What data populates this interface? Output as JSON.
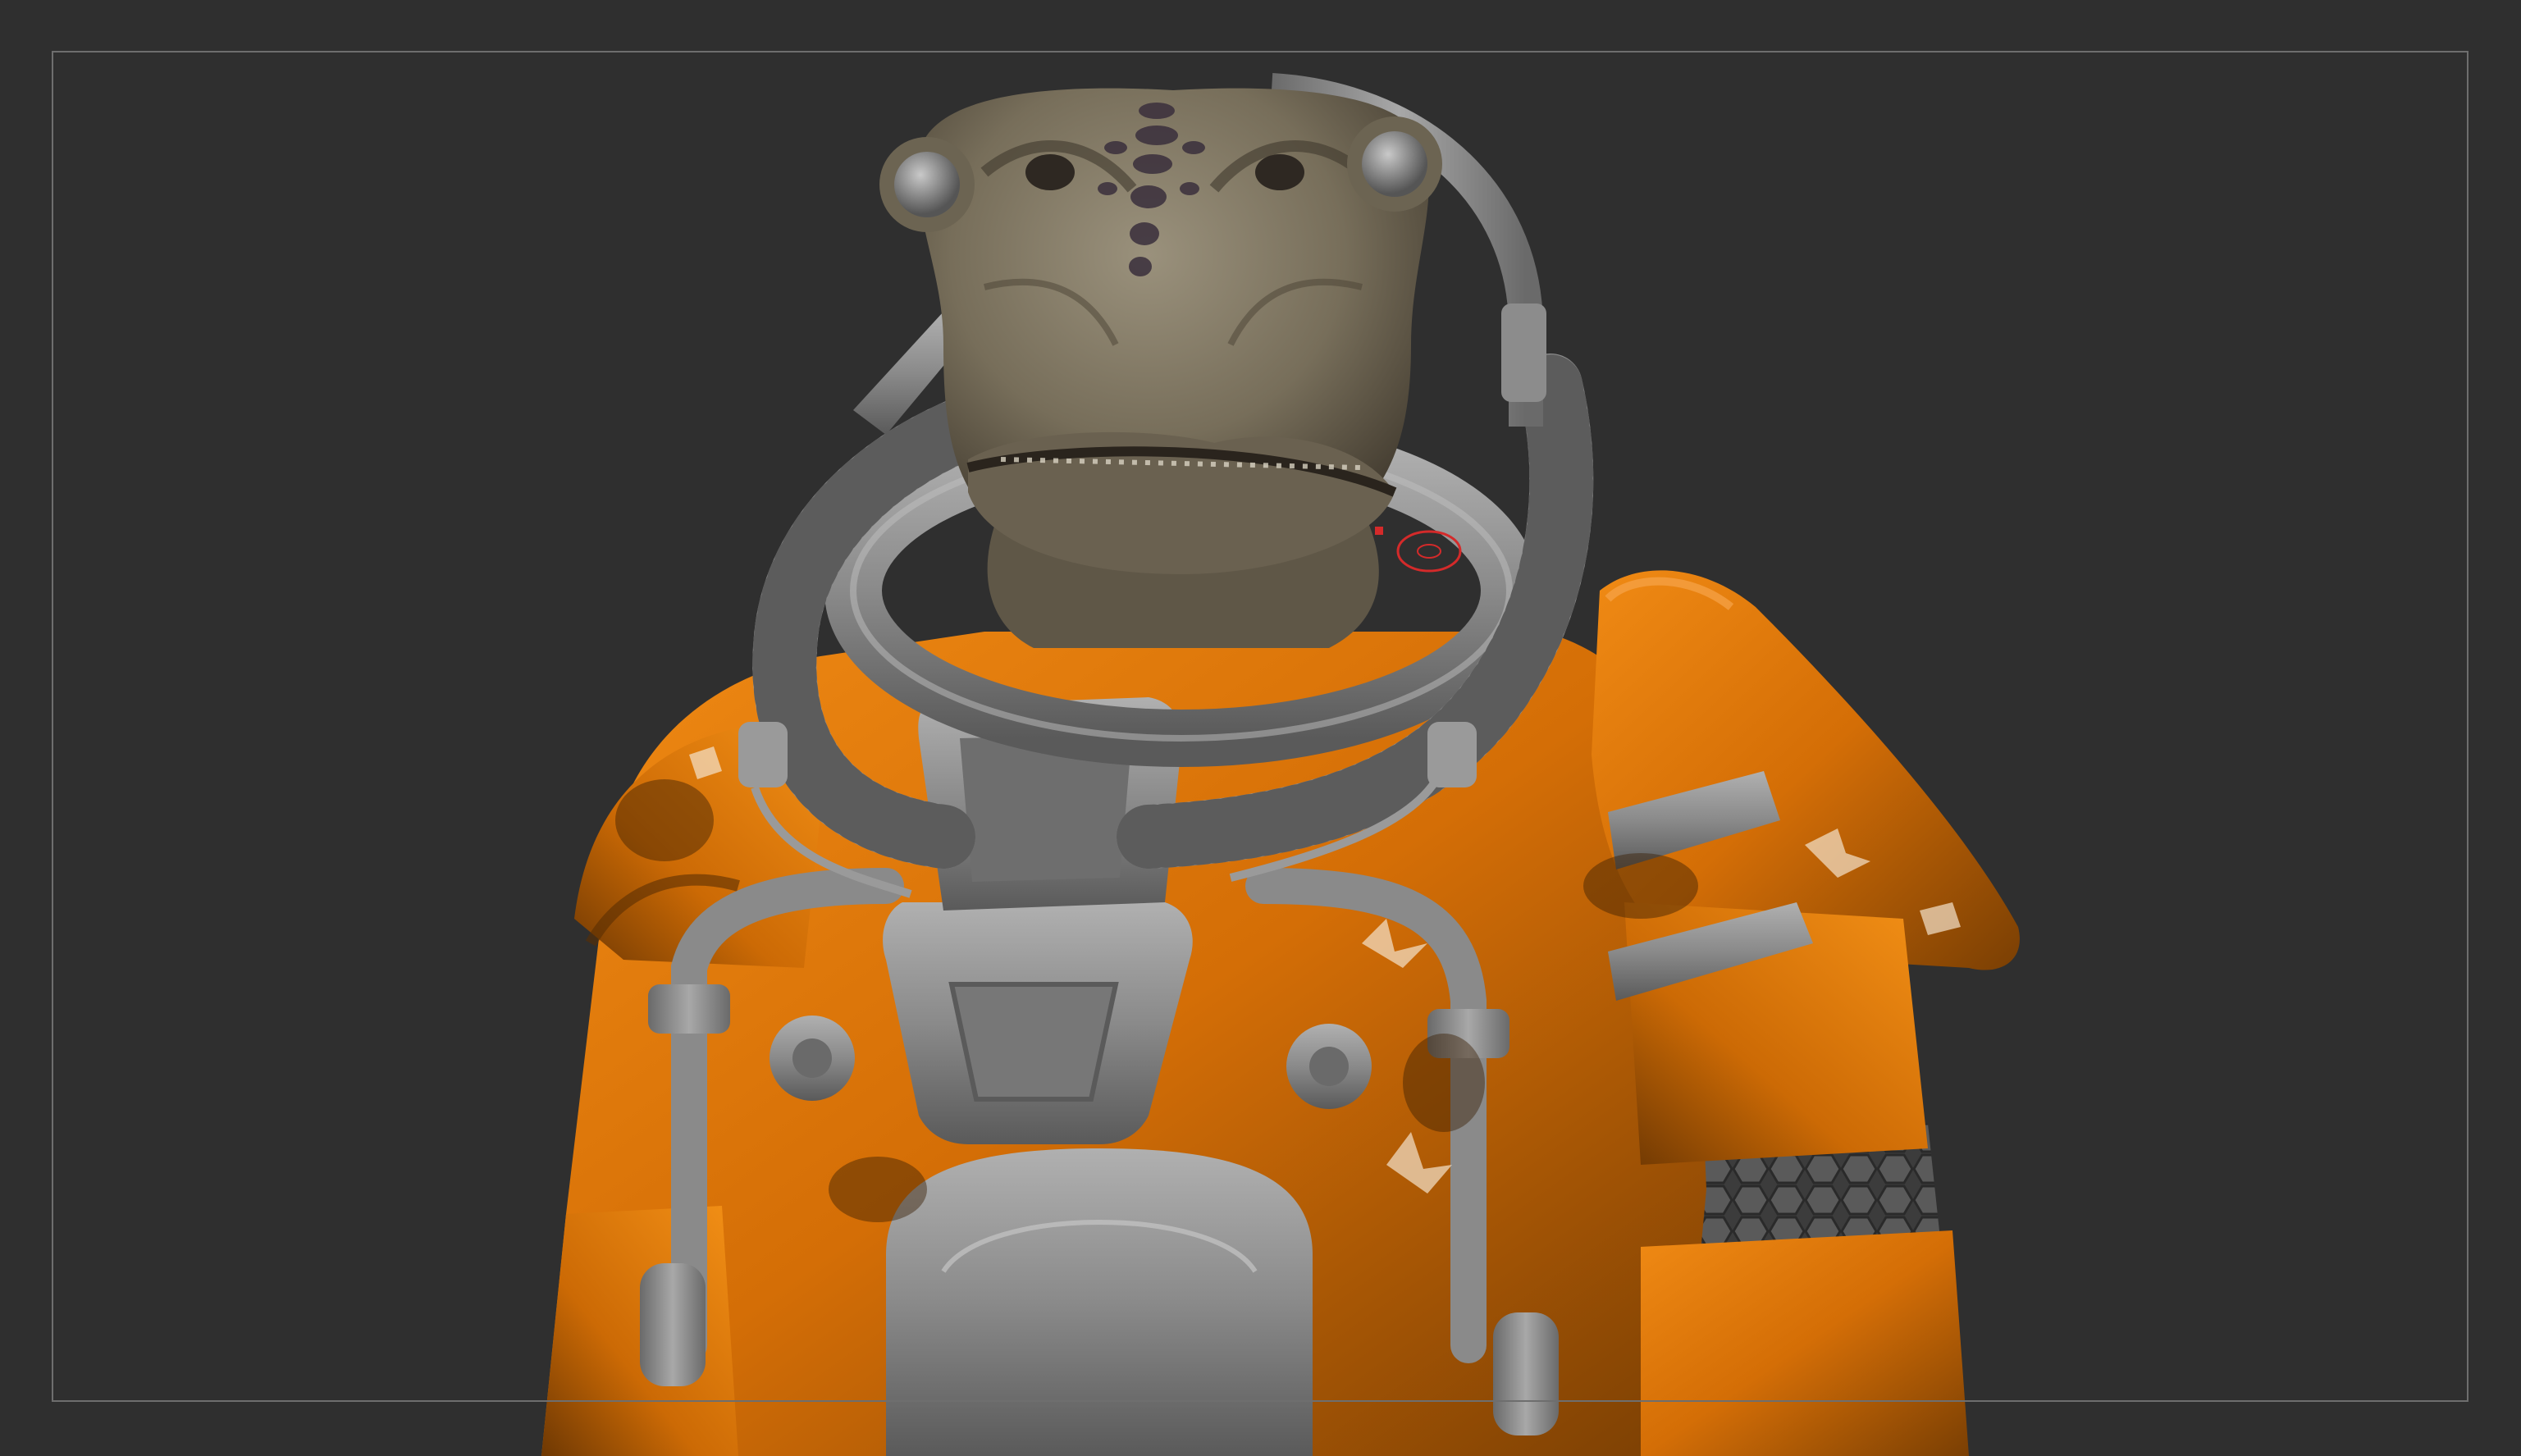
{
  "app": {
    "name": "",
    "view": "3d-viewport"
  },
  "colors": {
    "background": "#2f2f2f",
    "frame_border": "#6e6e6e",
    "suit_orange": "#e07a0a",
    "suit_orange_dark": "#8a4a06",
    "hardware_gray": "#8c8c8c",
    "hardware_gray_light": "#a9a9a9",
    "skin": "#7d7461",
    "skin_dark": "#4d4538",
    "skin_marking": "#3a2f3c",
    "cursor_red": "#d42a2a"
  },
  "scene": {
    "subject": "alien-astronaut-sculpt",
    "cursor": "brush-cursor-icon"
  }
}
